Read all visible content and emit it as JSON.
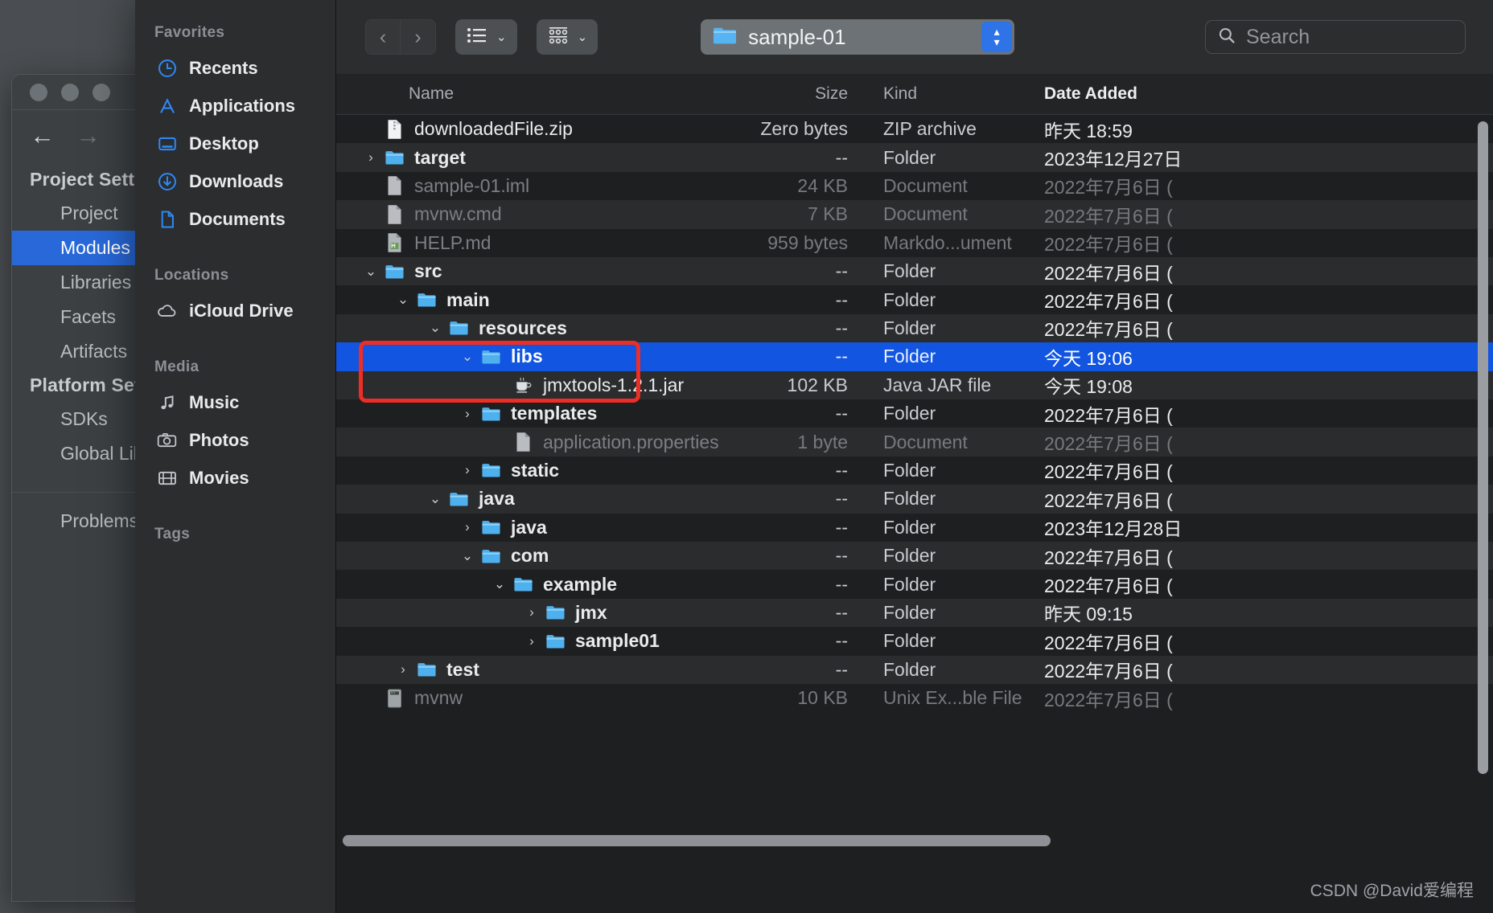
{
  "background_window": {
    "traffic_lights": [
      "close",
      "minimize",
      "zoom"
    ],
    "nav": {
      "back": "←",
      "forward": "→"
    },
    "groups": [
      {
        "title": "Project Setti",
        "items": [
          "Project",
          "Modules",
          "Libraries",
          "Facets",
          "Artifacts"
        ]
      },
      {
        "title": "Platform Set",
        "items": [
          "SDKs",
          "Global Lil"
        ]
      }
    ],
    "selected_item": "Modules",
    "tail_item": "Problems",
    "accent": "#2868d8"
  },
  "sidebar": {
    "sections": [
      {
        "title": "Favorites",
        "items": [
          {
            "label": "Recents",
            "icon": "clock-icon"
          },
          {
            "label": "Applications",
            "icon": "applications-icon"
          },
          {
            "label": "Desktop",
            "icon": "desktop-icon"
          },
          {
            "label": "Downloads",
            "icon": "download-icon"
          },
          {
            "label": "Documents",
            "icon": "document-icon"
          }
        ]
      },
      {
        "title": "Locations",
        "items": [
          {
            "label": "iCloud Drive",
            "icon": "cloud-icon"
          }
        ]
      },
      {
        "title": "Media",
        "items": [
          {
            "label": "Music",
            "icon": "music-note-icon"
          },
          {
            "label": "Photos",
            "icon": "camera-icon"
          },
          {
            "label": "Movies",
            "icon": "film-icon"
          }
        ]
      },
      {
        "title": "Tags",
        "items": []
      }
    ]
  },
  "toolbar": {
    "back_label": "‹",
    "forward_label": "›",
    "view_button": {
      "icon": "list-view-icon",
      "chevron": "⌄"
    },
    "group_button": {
      "icon": "grid-group-icon",
      "chevron": "⌄"
    },
    "path_button": {
      "label": "sample-01",
      "icon": "folder-icon",
      "stepper_up": "▴",
      "stepper_down": "▾"
    },
    "search": {
      "placeholder": "Search",
      "icon": "search-icon",
      "value": ""
    }
  },
  "columns": {
    "name": "Name",
    "size": "Size",
    "kind": "Kind",
    "date_added": "Date Added",
    "sorted_by": "Date Added"
  },
  "files": [
    {
      "name": "downloadedFile.zip",
      "size": "Zero bytes",
      "kind": "ZIP archive",
      "date": "昨天 18:59",
      "depth": 0,
      "icon": "zip-file-icon",
      "twisty": "",
      "type": "file",
      "state": "normal"
    },
    {
      "name": "target",
      "size": "--",
      "kind": "Folder",
      "date": "2023年12月27日",
      "depth": 0,
      "icon": "folder-icon",
      "twisty": "›",
      "type": "folder",
      "state": "normal"
    },
    {
      "name": "sample-01.iml",
      "size": "24 KB",
      "kind": "Document",
      "date": "2022年7月6日 (",
      "depth": 0,
      "icon": "doc-file-icon",
      "twisty": "",
      "type": "file",
      "state": "dim"
    },
    {
      "name": "mvnw.cmd",
      "size": "7 KB",
      "kind": "Document",
      "date": "2022年7月6日 (",
      "depth": 0,
      "icon": "doc-file-icon",
      "twisty": "",
      "type": "file",
      "state": "dim"
    },
    {
      "name": "HELP.md",
      "size": "959 bytes",
      "kind": "Markdo...ument",
      "date": "2022年7月6日 (",
      "depth": 0,
      "icon": "markdown-file-icon",
      "twisty": "",
      "type": "file",
      "state": "dim"
    },
    {
      "name": "src",
      "size": "--",
      "kind": "Folder",
      "date": "2022年7月6日 (",
      "depth": 0,
      "icon": "folder-icon",
      "twisty": "⌄",
      "type": "folder",
      "state": "normal"
    },
    {
      "name": "main",
      "size": "--",
      "kind": "Folder",
      "date": "2022年7月6日 (",
      "depth": 1,
      "icon": "folder-icon",
      "twisty": "⌄",
      "type": "folder",
      "state": "normal"
    },
    {
      "name": "resources",
      "size": "--",
      "kind": "Folder",
      "date": "2022年7月6日 (",
      "depth": 2,
      "icon": "folder-icon",
      "twisty": "⌄",
      "type": "folder",
      "state": "normal"
    },
    {
      "name": "libs",
      "size": "--",
      "kind": "Folder",
      "date": "今天 19:06",
      "depth": 3,
      "icon": "folder-icon",
      "twisty": "⌄",
      "type": "folder",
      "state": "selected"
    },
    {
      "name": "jmxtools-1.2.1.jar",
      "size": "102 KB",
      "kind": "Java JAR file",
      "date": "今天 19:08",
      "depth": 4,
      "icon": "jar-file-icon",
      "twisty": "",
      "type": "file",
      "state": "normal"
    },
    {
      "name": "templates",
      "size": "--",
      "kind": "Folder",
      "date": "2022年7月6日 (",
      "depth": 3,
      "icon": "folder-icon",
      "twisty": "›",
      "type": "folder",
      "state": "normal"
    },
    {
      "name": "application.properties",
      "size": "1 byte",
      "kind": "Document",
      "date": "2022年7月6日 (",
      "depth": 4,
      "icon": "doc-file-icon",
      "twisty": "",
      "type": "file",
      "state": "dim"
    },
    {
      "name": "static",
      "size": "--",
      "kind": "Folder",
      "date": "2022年7月6日 (",
      "depth": 3,
      "icon": "folder-icon",
      "twisty": "›",
      "type": "folder",
      "state": "normal"
    },
    {
      "name": "java",
      "size": "--",
      "kind": "Folder",
      "date": "2022年7月6日 (",
      "depth": 2,
      "icon": "folder-icon",
      "twisty": "⌄",
      "type": "folder",
      "state": "normal"
    },
    {
      "name": "java",
      "size": "--",
      "kind": "Folder",
      "date": "2023年12月28日",
      "depth": 3,
      "icon": "folder-icon",
      "twisty": "›",
      "type": "folder",
      "state": "normal"
    },
    {
      "name": "com",
      "size": "--",
      "kind": "Folder",
      "date": "2022年7月6日 (",
      "depth": 3,
      "icon": "folder-icon",
      "twisty": "⌄",
      "type": "folder",
      "state": "normal"
    },
    {
      "name": "example",
      "size": "--",
      "kind": "Folder",
      "date": "2022年7月6日 (",
      "depth": 4,
      "icon": "folder-icon",
      "twisty": "⌄",
      "type": "folder",
      "state": "normal"
    },
    {
      "name": "jmx",
      "size": "--",
      "kind": "Folder",
      "date": "昨天 09:15",
      "depth": 5,
      "icon": "folder-icon",
      "twisty": "›",
      "type": "folder",
      "state": "normal"
    },
    {
      "name": "sample01",
      "size": "--",
      "kind": "Folder",
      "date": "2022年7月6日 (",
      "depth": 5,
      "icon": "folder-icon",
      "twisty": "›",
      "type": "folder",
      "state": "normal"
    },
    {
      "name": "test",
      "size": "--",
      "kind": "Folder",
      "date": "2022年7月6日 (",
      "depth": 1,
      "icon": "folder-icon",
      "twisty": "›",
      "type": "folder",
      "state": "normal"
    },
    {
      "name": "mvnw",
      "size": "10 KB",
      "kind": "Unix Ex...ble File",
      "date": "2022年7月6日 (",
      "depth": 0,
      "icon": "unix-exec-icon",
      "twisty": "",
      "type": "file",
      "state": "dim"
    }
  ],
  "annotation": {
    "color": "#ee2d24",
    "covers": [
      "libs",
      "jmxtools-1.2.1.jar"
    ]
  },
  "footer": {
    "watermark": "CSDN @David爱编程"
  },
  "colors": {
    "selection": "#1255e0",
    "accent_blue": "#2f73e8",
    "folder_blue": "#5cb4f0"
  }
}
